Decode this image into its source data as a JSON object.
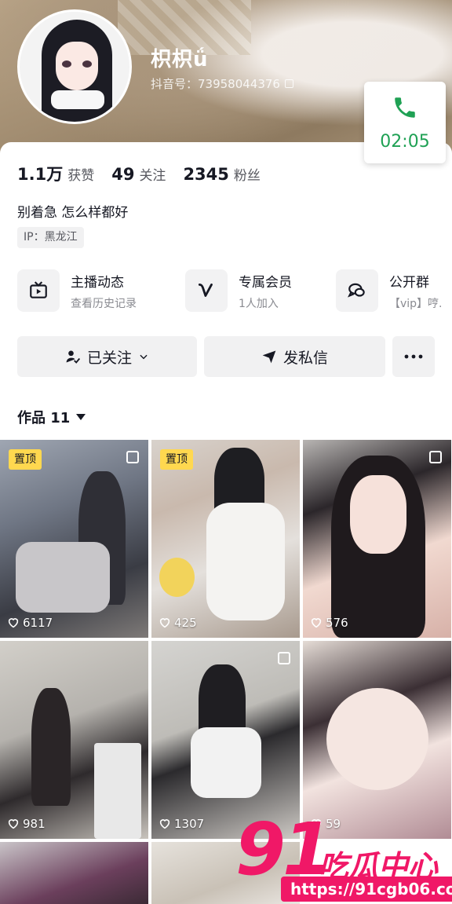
{
  "profile": {
    "nickname": "枳枳ǘ",
    "douyin_id": "抖音号：73958044376"
  },
  "call": {
    "duration": "02:05",
    "color": "#1fa154"
  },
  "stats": [
    {
      "value": "1.1万",
      "label": "获赞"
    },
    {
      "value": "49",
      "label": "关注"
    },
    {
      "value": "2345",
      "label": "粉丝"
    }
  ],
  "bio": "别着急 怎么样都好",
  "ip_tag": "IP：黑龙江",
  "features": [
    {
      "title": "主播动态",
      "subtitle": "查看历史记录",
      "icon": "tv-icon"
    },
    {
      "title": "专属会员",
      "subtitle": "1人加入",
      "icon": "v-icon"
    },
    {
      "title": "公开群",
      "subtitle": "【vip】哼.",
      "icon": "chat-bubbles-icon"
    }
  ],
  "actions": {
    "follow_label": "已关注",
    "message_label": "发私信"
  },
  "works_tab": "作品 11",
  "videos": [
    {
      "pinned_label": "置顶",
      "likes": "6117"
    },
    {
      "pinned_label": "置顶",
      "likes": "425"
    },
    {
      "pinned_label": "",
      "likes": "576"
    },
    {
      "pinned_label": "",
      "likes": "981"
    },
    {
      "pinned_label": "",
      "likes": "1307"
    },
    {
      "pinned_label": "",
      "likes": "59"
    }
  ],
  "watermark": {
    "number": "91",
    "name": "吃瓜中心",
    "url": "https://91cgb06.com",
    "color": "#f01867"
  }
}
